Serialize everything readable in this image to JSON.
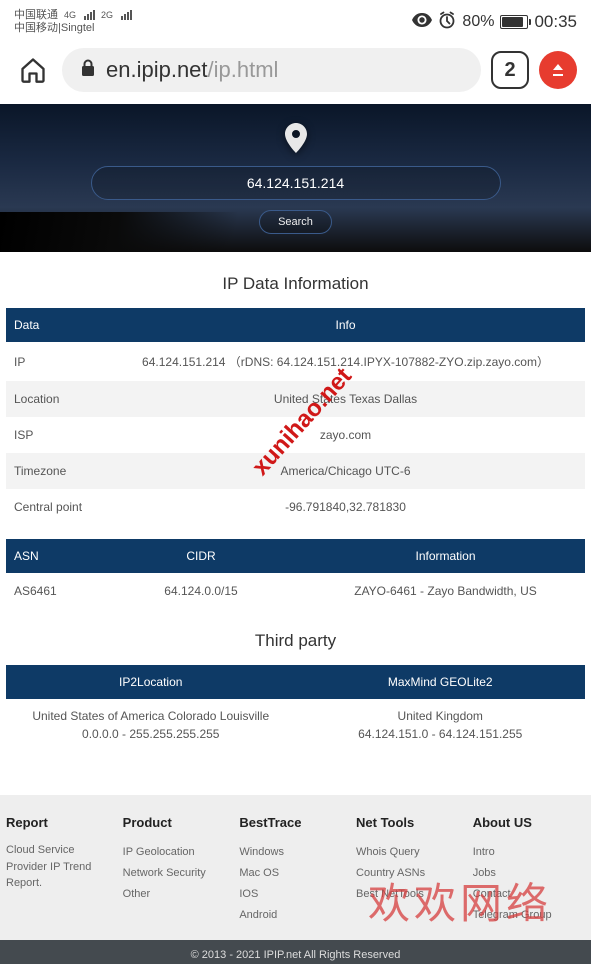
{
  "status": {
    "carrier1": "中国联通",
    "carrier2": "中国移动|Singtel",
    "sig1": "4G",
    "sig2": "2G",
    "battery": "80%",
    "time": "00:35"
  },
  "browser": {
    "domain": "en.ipip.net",
    "path": "/ip.html",
    "tabs": "2"
  },
  "hero": {
    "ip": "64.124.151.214",
    "search": "Search"
  },
  "section1_title": "IP Data Information",
  "headers1": {
    "data": "Data",
    "info": "Info"
  },
  "rows": [
    {
      "label": "IP",
      "info": "64.124.151.214       （rDNS: 64.124.151.214.IPYX-107882-ZYO.zip.zayo.com）"
    },
    {
      "label": "Location",
      "info": "United States Texas Dallas"
    },
    {
      "label": "ISP",
      "info": "zayo.com"
    },
    {
      "label": "Timezone",
      "info": "America/Chicago UTC-6"
    },
    {
      "label": "Central point",
      "info": "-96.791840,32.781830"
    }
  ],
  "headers2": {
    "asn": "ASN",
    "cidr": "CIDR",
    "info": "Information"
  },
  "asn_row": {
    "asn": "AS6461",
    "cidr": "64.124.0.0/15",
    "info": "ZAYO-6461 - Zayo Bandwidth, US"
  },
  "section2_title": "Third party",
  "headers3": {
    "ip2": "IP2Location",
    "mm": "MaxMind GEOLite2"
  },
  "third_row": {
    "ip2_line1": "United States of America Colorado Louisville",
    "ip2_line2": "0.0.0.0 - 255.255.255.255",
    "mm_line1": "United Kingdom",
    "mm_line2": "64.124.151.0 - 64.124.151.255"
  },
  "footer": {
    "report": {
      "title": "Report",
      "text": "Cloud Service Provider IP Trend Report."
    },
    "product": {
      "title": "Product",
      "items": [
        "IP Geolocation",
        "Network Security",
        "Other"
      ]
    },
    "best": {
      "title": "BestTrace",
      "items": [
        "Windows",
        "Mac OS",
        "IOS",
        "Android"
      ]
    },
    "net": {
      "title": "Net Tools",
      "items": [
        "Whois Query",
        "Country ASNs",
        "Best NetTools"
      ]
    },
    "about": {
      "title": "About US",
      "items": [
        "Intro",
        "Jobs",
        "Contact",
        "Telegram Group"
      ]
    }
  },
  "copyright": "© 2013 - 2021 IPIP.net All Rights Reserved",
  "wm1": "xunihao.net",
  "wm2": "欢欢网络"
}
